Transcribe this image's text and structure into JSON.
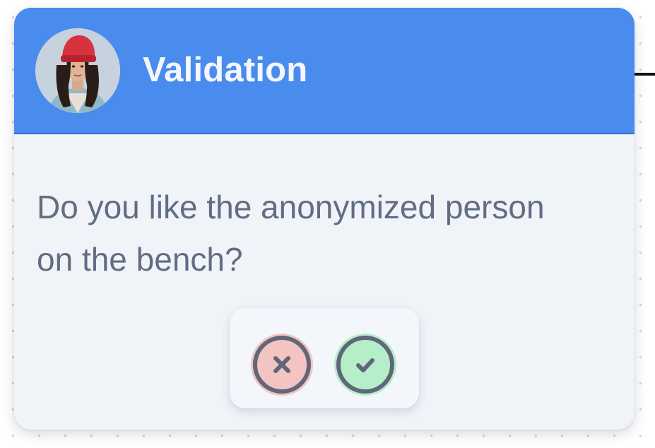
{
  "card": {
    "title": "Validation",
    "message": "Do you like the anonymized person on the bench?",
    "avatar": "user-avatar-photo"
  },
  "actions": {
    "reject": {
      "icon": "close-icon",
      "color": "#f3c4c2"
    },
    "accept": {
      "icon": "checkmark-icon",
      "color": "#b6eec9"
    }
  },
  "colors": {
    "header": "#4a8bee",
    "card_background": "#f0f4f9",
    "message_text": "#626d84",
    "icon_stroke": "#5f6779"
  }
}
